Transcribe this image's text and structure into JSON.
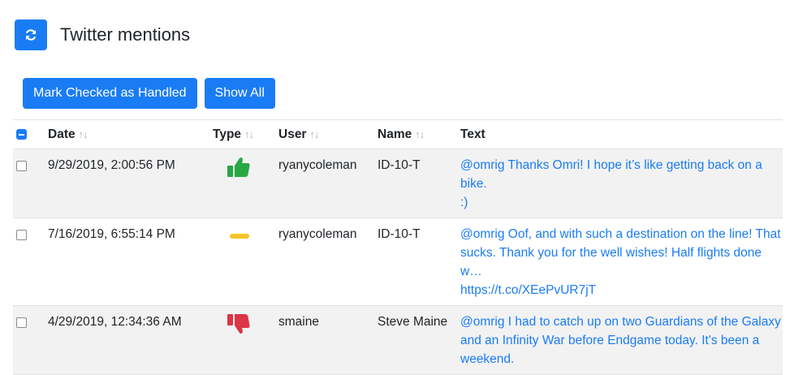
{
  "header": {
    "title": "Twitter mentions",
    "refresh_icon": "refresh-icon"
  },
  "actions": {
    "mark_handled": "Mark Checked as Handled",
    "show_all": "Show All"
  },
  "columns": {
    "date": "Date",
    "type": "Type",
    "user": "User",
    "name": "Name",
    "text": "Text"
  },
  "colors": {
    "accent": "#1a7cf5",
    "positive": "#28a745",
    "neutral": "#f7c528",
    "negative": "#dc3545"
  },
  "rows": [
    {
      "date": "9/29/2019, 2:00:56 PM",
      "type": "positive",
      "type_icon": "thumbs-up-icon",
      "user": "ryanycoleman",
      "name": "ID-10-T",
      "text_lines": [
        "@omrig Thanks Omri! I hope it’s like getting back on a bike.",
        ":)"
      ]
    },
    {
      "date": "7/16/2019, 6:55:14 PM",
      "type": "neutral",
      "type_icon": "neutral-bar-icon",
      "user": "ryanycoleman",
      "name": "ID-10-T",
      "text_lines": [
        "@omrig Oof, and with such a destination on the line! That",
        "sucks. Thank you for the well wishes! Half flights done w…",
        "https://t.co/XEePvUR7jT"
      ]
    },
    {
      "date": "4/29/2019, 12:34:36 AM",
      "type": "negative",
      "type_icon": "thumbs-down-icon",
      "user": "smaine",
      "name": "Steve Maine",
      "text_lines": [
        "@omrig I had to catch up on two Guardians of the Galaxy",
        "and an Infinity War before Endgame today. It's been a",
        "weekend."
      ]
    }
  ]
}
